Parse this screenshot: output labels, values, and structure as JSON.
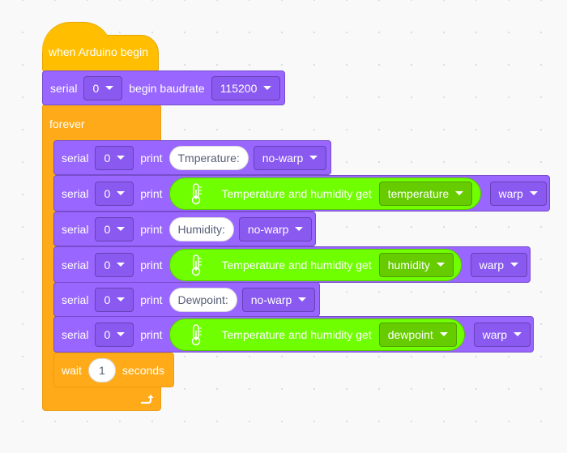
{
  "hat": {
    "label": "when Arduino begin"
  },
  "begin_block": {
    "serial_label": "serial",
    "port": "0",
    "begin_label": "begin baudrate",
    "baudrate": "115200"
  },
  "forever": {
    "label": "forever"
  },
  "rows": [
    {
      "serial_label": "serial",
      "port": "0",
      "print_label": "print",
      "kind": "text",
      "text": "Tmperature:",
      "mode": "no-warp"
    },
    {
      "serial_label": "serial",
      "port": "0",
      "print_label": "print",
      "kind": "sensor",
      "sensor_label": "Temperature and humidity get",
      "sensor_value": "temperature",
      "mode": "warp"
    },
    {
      "serial_label": "serial",
      "port": "0",
      "print_label": "print",
      "kind": "text",
      "text": "Humidity:",
      "mode": "no-warp"
    },
    {
      "serial_label": "serial",
      "port": "0",
      "print_label": "print",
      "kind": "sensor",
      "sensor_label": "Temperature and humidity get",
      "sensor_value": "humidity",
      "mode": "warp"
    },
    {
      "serial_label": "serial",
      "port": "0",
      "print_label": "print",
      "kind": "text",
      "text": "Dewpoint:",
      "mode": "no-warp"
    },
    {
      "serial_label": "serial",
      "port": "0",
      "print_label": "print",
      "kind": "sensor",
      "sensor_label": "Temperature and humidity get",
      "sensor_value": "dewpoint",
      "mode": "warp"
    }
  ],
  "wait": {
    "label": "wait",
    "value": "1",
    "unit": "seconds"
  },
  "colors": {
    "events": "#ffbf00",
    "control": "#ffab19",
    "serial": "#9966ff",
    "sensor": "#70ff00",
    "sensor_dropdown": "#66cc00"
  },
  "icons": {
    "loop_arrow": "loop-arrow-icon",
    "thermometer": "thermometer-icon",
    "dropdown": "chevron-down-icon"
  }
}
